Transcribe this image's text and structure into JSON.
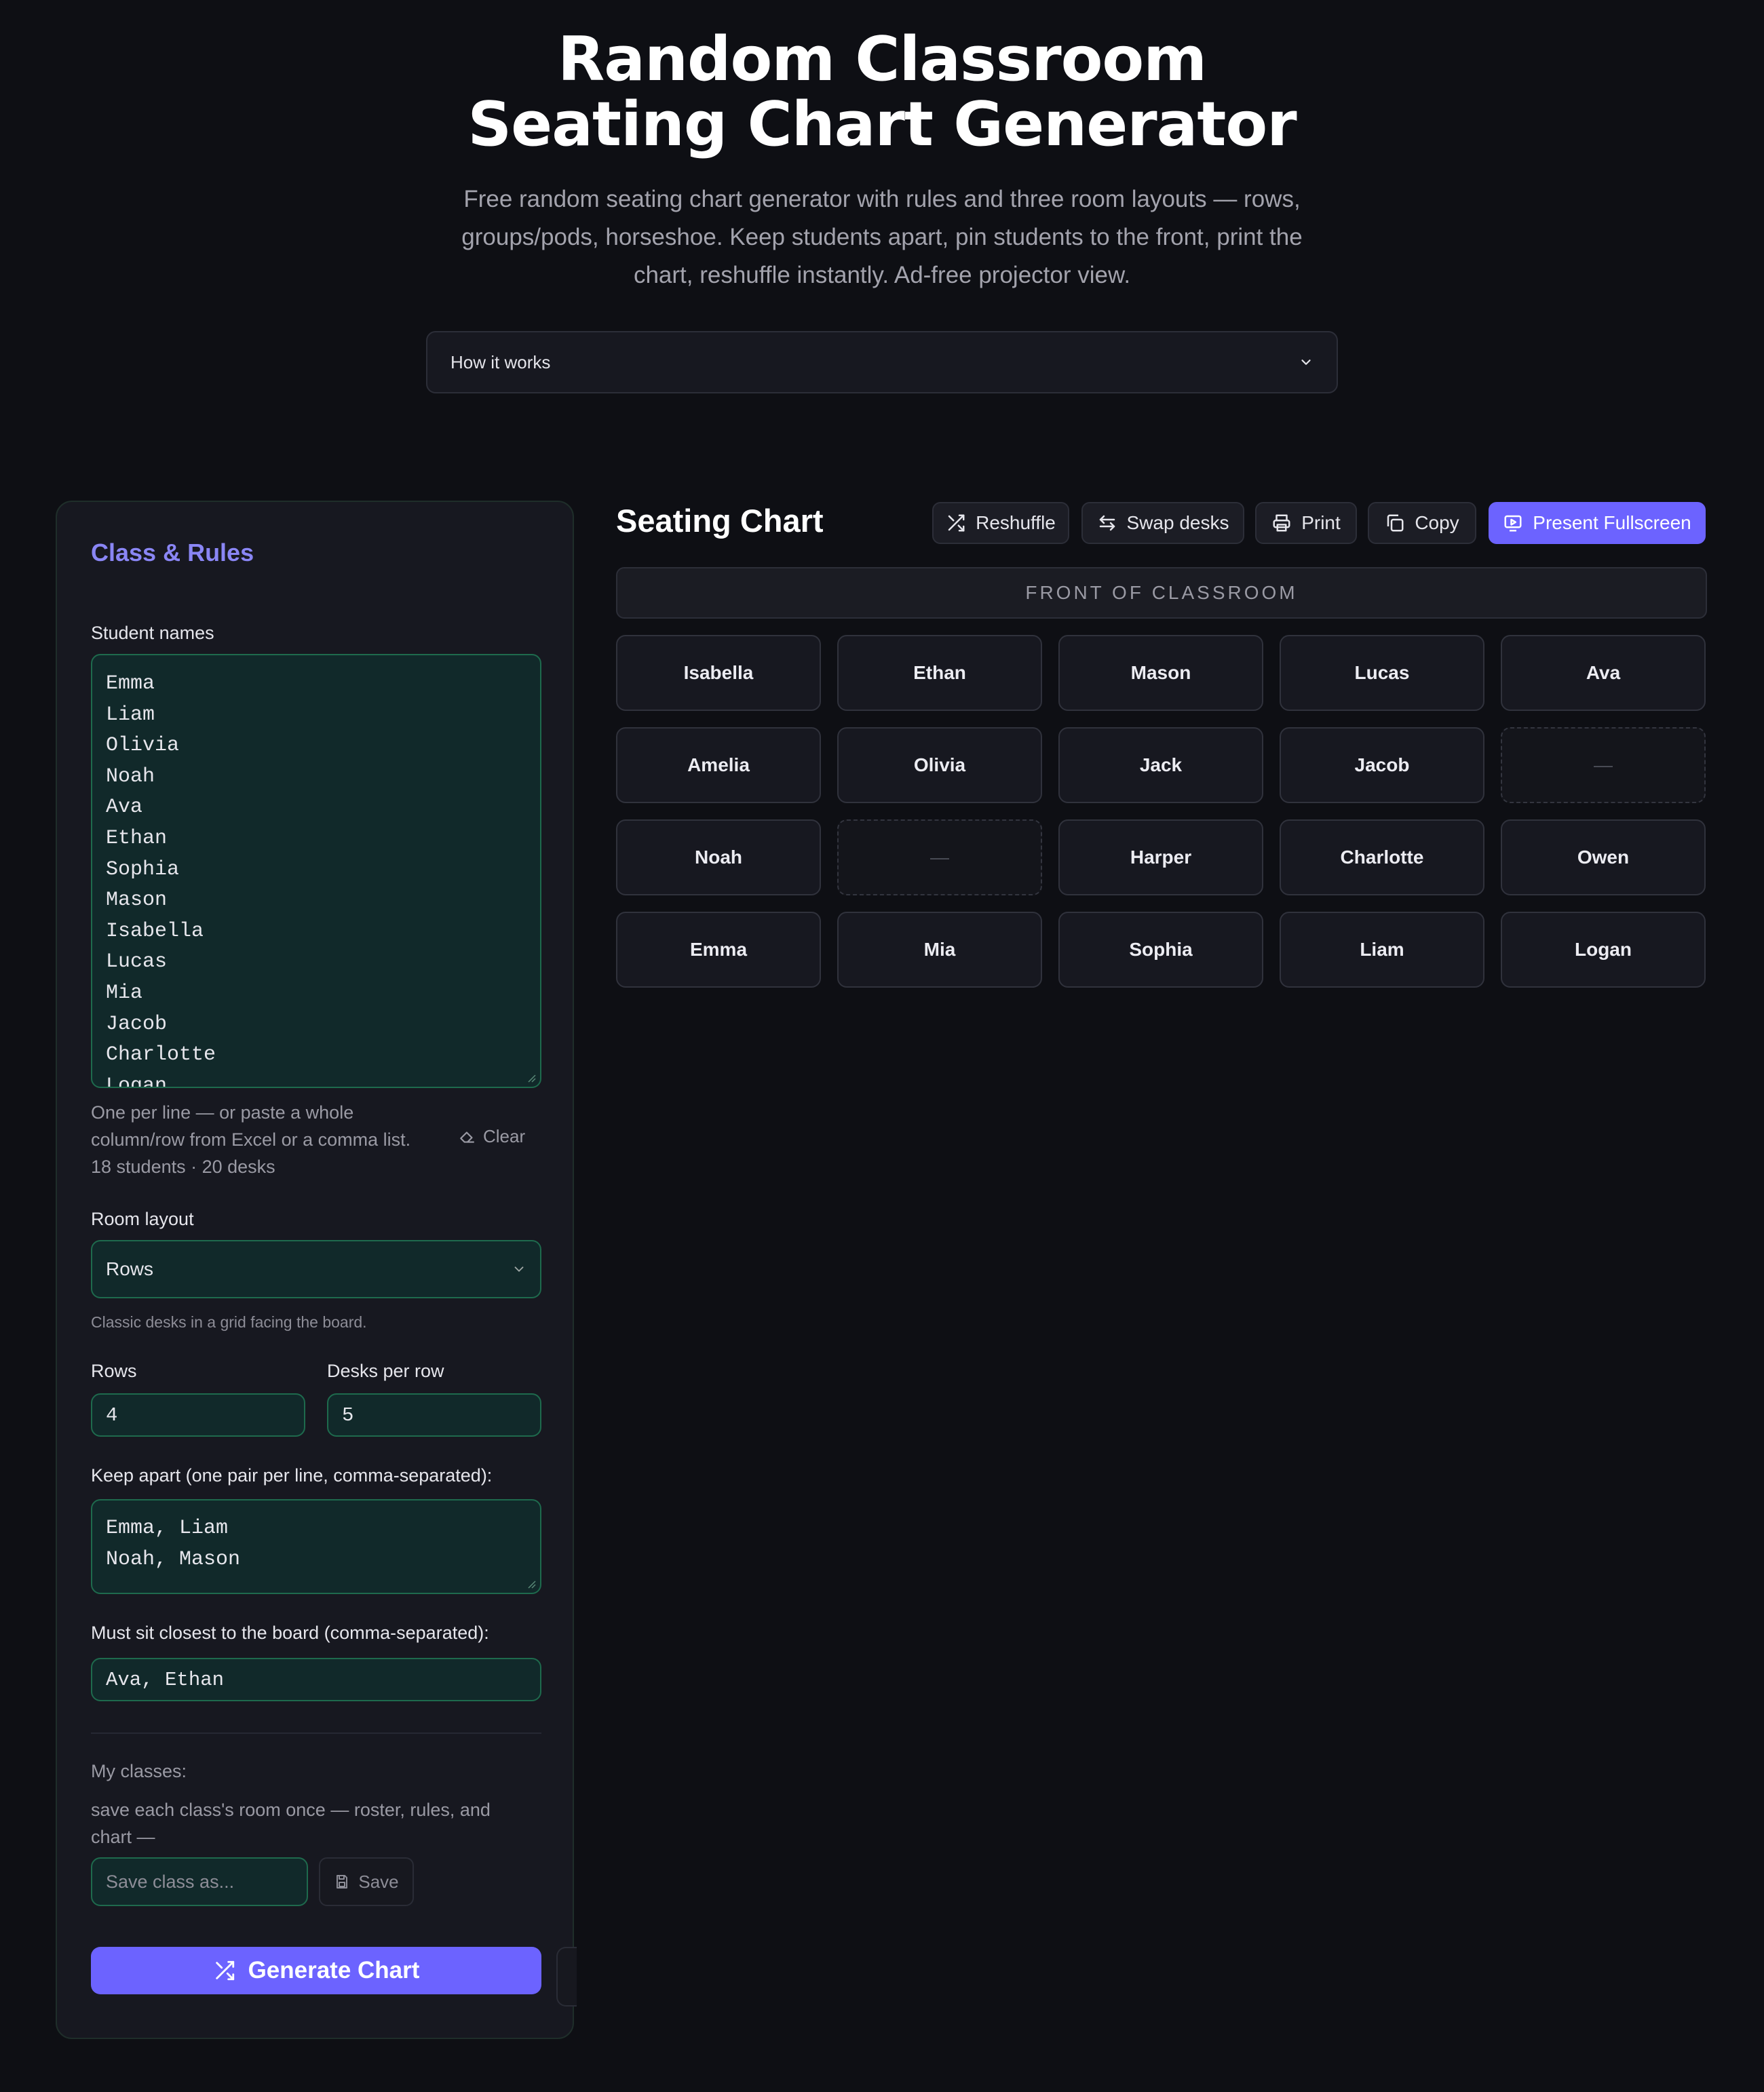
{
  "header": {
    "title_line1": "Random Classroom",
    "title_line2": "Seating Chart Generator",
    "subtitle": "Free random seating chart generator with rules and three room layouts — rows, groups/pods, horseshoe. Keep students apart, pin students to the front, print the chart, reshuffle instantly. Ad-free projector view.",
    "how_it_works": "How it works"
  },
  "panel": {
    "title": "Class & Rules",
    "student_names_label": "Student names",
    "student_names": [
      "Emma",
      "Liam",
      "Olivia",
      "Noah",
      "Ava",
      "Ethan",
      "Sophia",
      "Mason",
      "Isabella",
      "Lucas",
      "Mia",
      "Jacob",
      "Charlotte",
      "Logan"
    ],
    "names_hint_line1": "One per line — or paste a whole",
    "names_hint_line2": "column/row from Excel or a comma list.",
    "count_text": "18 students · 20 desks",
    "clear_label": "Clear",
    "room_layout_label": "Room layout",
    "room_layout_value": "Rows",
    "room_layout_hint": "Classic desks in a grid facing the board.",
    "rows_label": "Rows",
    "rows_value": "4",
    "desks_per_row_label": "Desks per row",
    "desks_per_row_value": "5",
    "keep_apart_label": "Keep apart (one pair per line, comma-separated):",
    "keep_apart": [
      "Emma, Liam",
      "Noah, Mason"
    ],
    "front_label": "Must sit closest to the board (comma-separated):",
    "front_value": "Ava, Ethan",
    "my_classes_label": "My classes:",
    "my_classes_hint": "save each class's room once — roster, rules, and chart —",
    "save_placeholder": "Save class as...",
    "save_label": "Save",
    "generate_label": "Generate Chart"
  },
  "chart": {
    "title": "Seating Chart",
    "toolbar": {
      "reshuffle": "Reshuffle",
      "swap": "Swap desks",
      "print": "Print",
      "copy": "Copy",
      "present": "Present Fullscreen"
    },
    "front_label": "FRONT OF CLASSROOM",
    "empty_label": "—",
    "rows": [
      [
        "Isabella",
        "Ethan",
        "Mason",
        "Lucas",
        "Ava"
      ],
      [
        "Amelia",
        "Olivia",
        "Jack",
        "Jacob",
        ""
      ],
      [
        "Noah",
        "",
        "Harper",
        "Charlotte",
        "Owen"
      ],
      [
        "Emma",
        "Mia",
        "Sophia",
        "Liam",
        "Logan"
      ]
    ]
  },
  "colors": {
    "accent": "#6c63ff",
    "panel_title": "#8a86f5",
    "field_border": "#1e6a4d",
    "field_bg": "#11292a"
  },
  "icons": [
    "chevron-down-icon",
    "shuffle-icon",
    "swap-icon",
    "printer-icon",
    "copy-icon",
    "presentation-icon",
    "eraser-icon",
    "save-icon"
  ]
}
